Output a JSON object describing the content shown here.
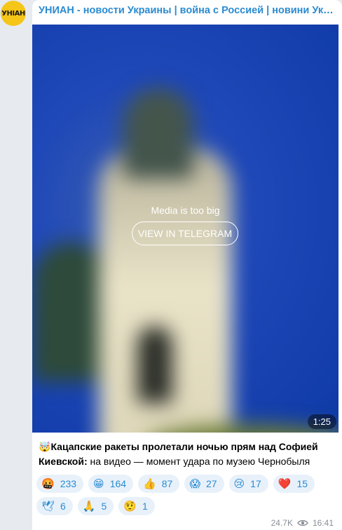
{
  "channel": {
    "avatar_text": "УНІАН",
    "title": "УНИАН - новости Украины | война с Россией | новини України..."
  },
  "media": {
    "message": "Media is too big",
    "button_label": "VIEW IN TELEGRAM",
    "duration": "1:25"
  },
  "caption": {
    "emoji": "🤯",
    "bold": "Кацапские ракеты пролетали ночью прям над Софией Киевской:",
    "rest": " на видео — момент удара по музею Чернобыля"
  },
  "reactions": [
    {
      "emoji": "🤬",
      "count": "233"
    },
    {
      "emoji": "😁",
      "count": "164"
    },
    {
      "emoji": "👍",
      "count": "87"
    },
    {
      "emoji": "😱",
      "count": "27"
    },
    {
      "emoji": "😢",
      "count": "17"
    },
    {
      "emoji": "❤️",
      "count": "15"
    },
    {
      "emoji": "🕊",
      "count": "6"
    },
    {
      "emoji": "🙏",
      "count": "5"
    },
    {
      "emoji": "🤨",
      "count": "1"
    }
  ],
  "footer": {
    "views": "24.7K",
    "time": "16:41"
  }
}
